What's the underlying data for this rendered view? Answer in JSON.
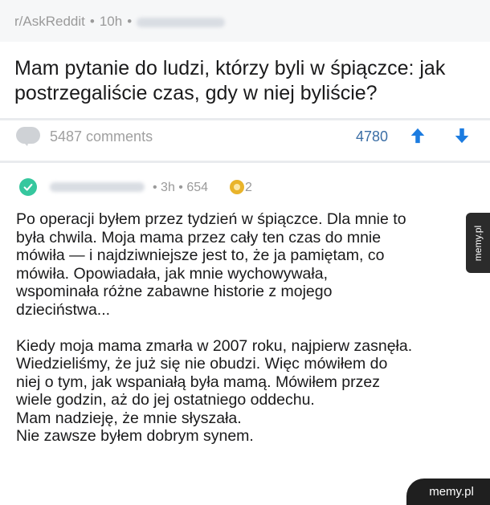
{
  "post": {
    "subreddit": "r/AskReddit",
    "time": "10h",
    "title": "Mam pytanie do ludzi, którzy byli w śpiączce: jak postrzegaliście czas, gdy w niej byliście?",
    "comments_label": "5487 comments",
    "score": "4780"
  },
  "comment": {
    "time": "3h",
    "points": "654",
    "awards": "2",
    "body": "Po operacji byłem przez tydzień w śpiączce. Dla mnie to\nbyła chwila. Moja mama przez cały ten czas do mnie\nmówiła — i najdziwniejsze jest to, że ja pamiętam, co\nmówiła. Opowiadała, jak mnie wychowywała,\nwspominała różne zabawne historie z mojego\ndzieciństwa...\n\nKiedy moja mama zmarła w 2007 roku, najpierw zasnęła.\nWiedzieliśmy, że już się nie obudzi. Więc mówiłem do\nniej o tym, jak wspaniałą była mamą. Mówiłem przez\nwiele godzin, aż do jej ostatniego oddechu.\nMam nadzieję, że mnie słyszała.\nNie zawsze byłem dobrym synem."
  },
  "watermark": {
    "side": "memy.pl",
    "corner": "memy.pl"
  },
  "icons": {
    "comments": "speech-bubble-icon",
    "upvote": "arrow-up-icon",
    "downvote": "arrow-down-icon",
    "verified": "check-circle-icon",
    "award": "coin-award-icon"
  },
  "colors": {
    "header_bg": "#f6f7f8",
    "vote_blue": "#1c7ce0",
    "score_blue": "#3b6ea5",
    "check_green": "#36c79e",
    "award_gold": "#e9b42b",
    "meta_gray": "#9a9a9a"
  }
}
